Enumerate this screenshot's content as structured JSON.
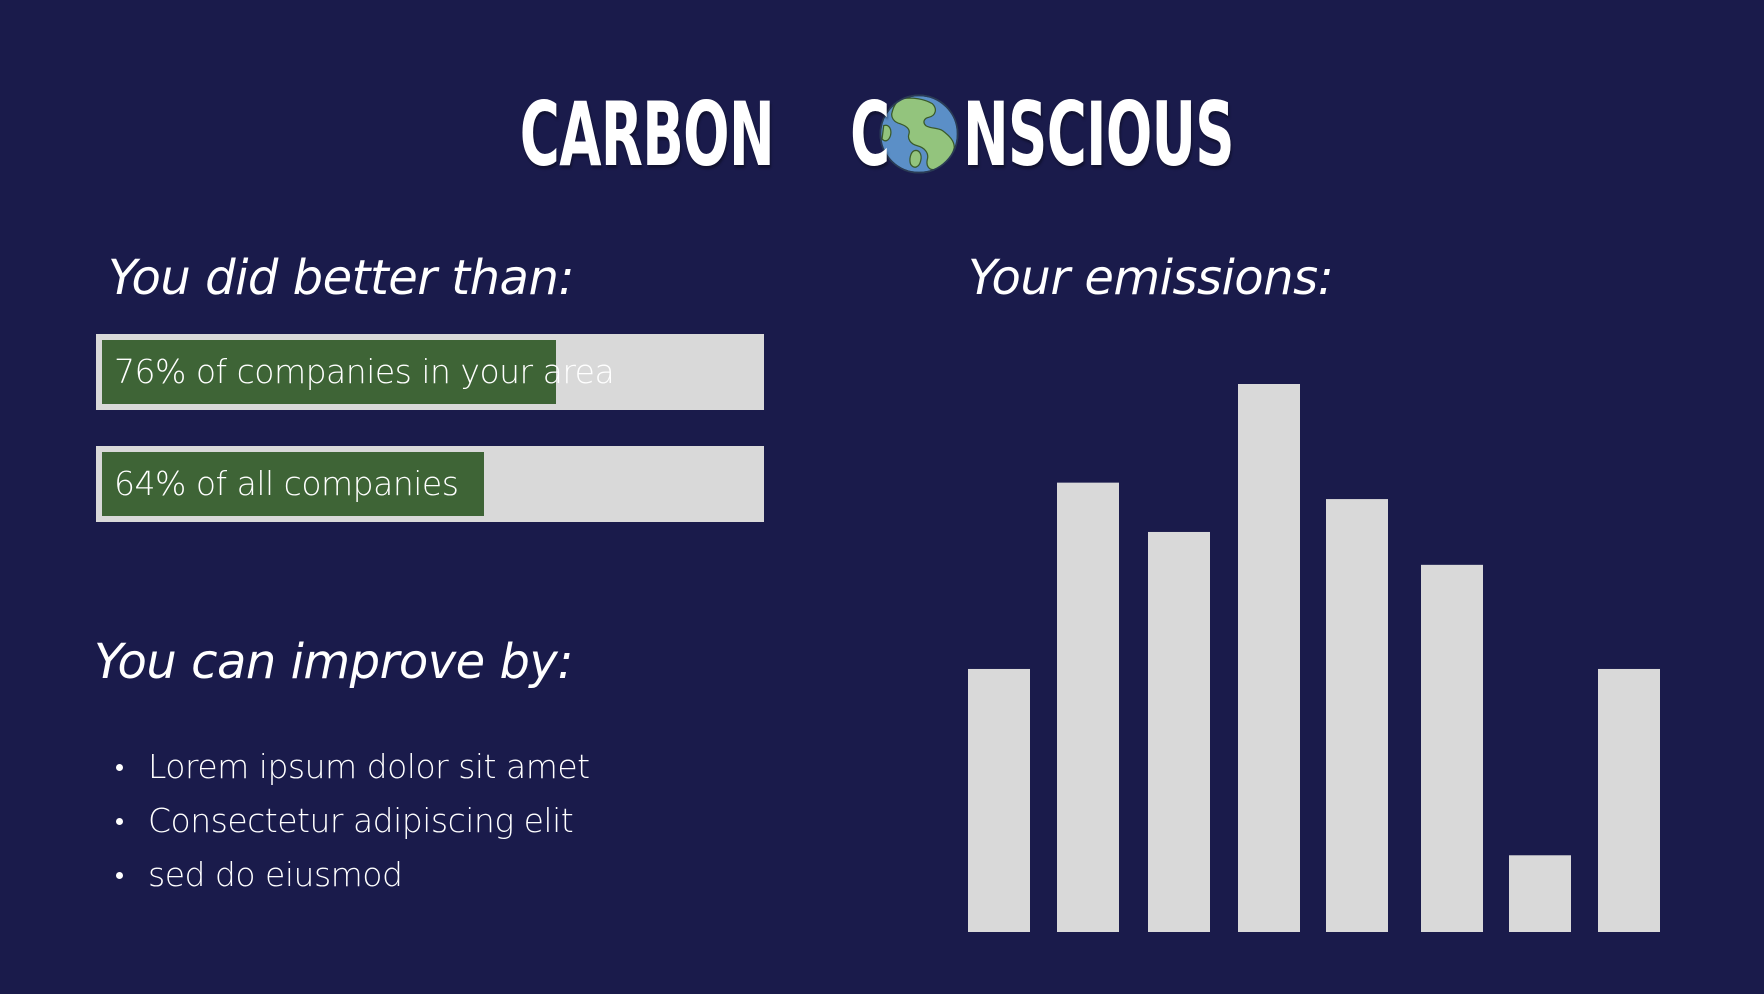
{
  "title": {
    "word1": "CARBON",
    "word2_first": "C",
    "word2_rest": "NSCIOUS",
    "globe_icon": "globe-icon"
  },
  "better": {
    "heading": "You did better than:",
    "bars": [
      {
        "label": "76% of companies in your area",
        "fraction": 0.76
      },
      {
        "label": "64% of all companies",
        "fraction": 0.64
      }
    ]
  },
  "improve": {
    "heading": "You can improve by:",
    "items": [
      "Lorem ipsum dolor sit amet",
      "Consectetur adipiscing elit",
      "sed do eiusmod"
    ]
  },
  "emissions": {
    "heading": "Your emissions:"
  },
  "colors": {
    "background": "#1a1b4b",
    "bar_track": "#d9d9d9",
    "bar_fill": "#3e6436",
    "chart_bar": "#d9d9d9"
  },
  "chart_data": {
    "type": "bar",
    "categories": [
      "",
      "",
      "",
      "",
      "",
      "",
      "",
      ""
    ],
    "values": [
      48,
      82,
      73,
      100,
      79,
      67,
      14,
      48
    ],
    "title": "",
    "xlabel": "",
    "ylabel": "",
    "ylim": [
      0,
      100
    ],
    "grid": false
  }
}
